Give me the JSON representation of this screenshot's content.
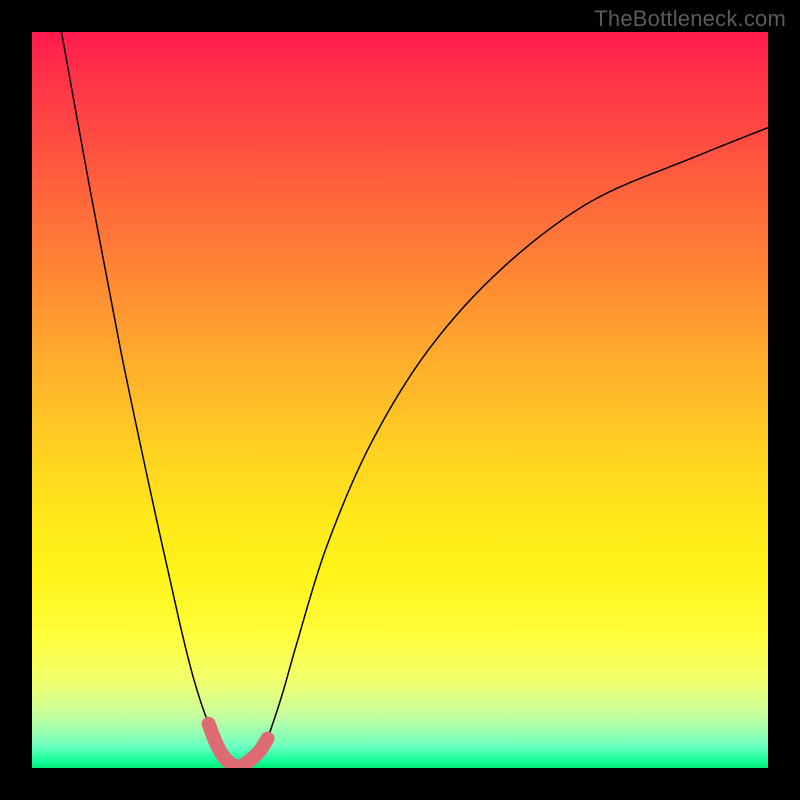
{
  "watermark": "TheBottleneck.com",
  "chart_data": {
    "type": "line",
    "title": "",
    "xlabel": "",
    "ylabel": "",
    "xlim": [
      0,
      100
    ],
    "ylim": [
      0,
      100
    ],
    "grid": false,
    "legend": false,
    "background_gradient": {
      "direction": "vertical",
      "stops": [
        {
          "pos": 0,
          "color": "#ff1a4d"
        },
        {
          "pos": 25,
          "color": "#ff7a36"
        },
        {
          "pos": 55,
          "color": "#ffd21f"
        },
        {
          "pos": 82,
          "color": "#fffe3c"
        },
        {
          "pos": 100,
          "color": "#00e878"
        }
      ]
    },
    "series": [
      {
        "name": "bottleneck-curve",
        "color": "#000000",
        "x": [
          4,
          8,
          12,
          16,
          20,
          22,
          24,
          26,
          27,
          28,
          29,
          30,
          31,
          32,
          34,
          36,
          40,
          46,
          54,
          64,
          76,
          90,
          100
        ],
        "y": [
          100,
          78,
          57,
          38,
          20,
          12,
          6,
          2,
          0.6,
          0.2,
          0.2,
          0.6,
          1.8,
          4,
          10,
          17,
          30,
          44,
          57,
          68,
          77,
          83,
          87
        ]
      }
    ],
    "highlight": {
      "name": "min-region",
      "color": "#de6b72",
      "x": [
        24,
        25,
        26,
        27,
        28,
        29,
        30,
        31,
        32
      ],
      "y": [
        6,
        3.4,
        1.6,
        0.6,
        0.2,
        0.6,
        1.4,
        2.4,
        4
      ]
    }
  }
}
